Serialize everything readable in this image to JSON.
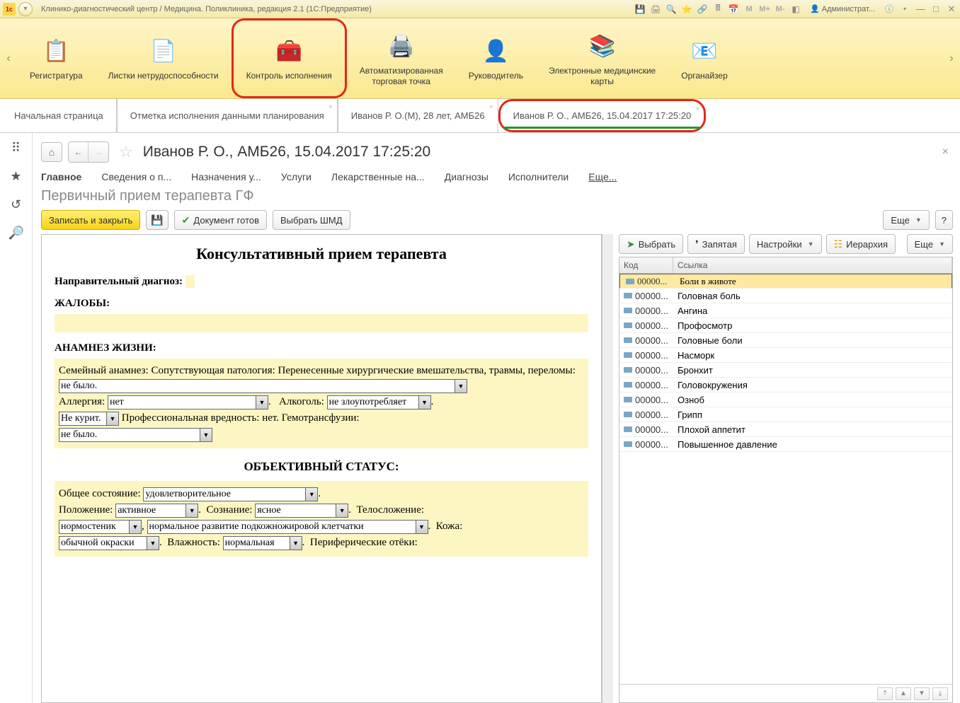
{
  "titlebar": {
    "app_title": "Клинико-диагностический центр / Медицина. Поликлиника, редакция 2.1  (1С:Предприятие)",
    "user": "Администрат...",
    "icons": {
      "m": "M",
      "mplus": "M+",
      "mminus": "M-"
    }
  },
  "main_toolbar": {
    "items": [
      {
        "label": "Регистратура",
        "icon": "📋"
      },
      {
        "label": "Листки нетрудоспособности",
        "icon": "📄"
      },
      {
        "label": "Контроль исполнения",
        "icon": "🧰",
        "highlighted": true
      },
      {
        "label": "Автоматизированная\nторговая точка",
        "icon": "🖨️"
      },
      {
        "label": "Руководитель",
        "icon": "👤"
      },
      {
        "label": "Электронные медицинские\nкарты",
        "icon": "📚"
      },
      {
        "label": "Органайзер",
        "icon": "📧"
      }
    ]
  },
  "tabs": [
    {
      "label": "Начальная страница",
      "closable": false
    },
    {
      "label": "Отметка исполнения данными планирования",
      "closable": true
    },
    {
      "label": "Иванов Р. О.(М), 28 лет, АМБ26",
      "closable": true
    },
    {
      "label": "Иванов Р. О., АМБ26, 15.04.2017 17:25:20",
      "closable": true,
      "active": true
    }
  ],
  "pane": {
    "title": "Иванов Р. О., АМБ26, 15.04.2017 17:25:20",
    "subtitle": "Первичный прием терапевта ГФ"
  },
  "hnav": [
    "Главное",
    "Сведения о п...",
    "Назначения у...",
    "Услуги",
    "Лекарственные на...",
    "Диагнозы",
    "Исполнители",
    "Еще..."
  ],
  "cmd": {
    "save_close": "Записать и закрыть",
    "doc_ready": "Документ готов",
    "choose_shmd": "Выбрать ШМД",
    "more": "Еще",
    "help": "?"
  },
  "doc": {
    "title": "Консультативный прием терапевта",
    "diag_label": "Направительный диагноз:",
    "complaints_label": "ЖАЛОБЫ:",
    "anamnesis_label": "АНАМНЕЗ ЖИЗНИ:",
    "anamnesis_text": "Семейный анамнез:  Сопутствующая патология:   Перенесенные хирургические вмешательства, травмы, переломы:",
    "nebilo": "не было.",
    "allergy_label": "Аллергия:",
    "allergy_val": "нет",
    "alcohol_label": "Алкоголь:",
    "alcohol_val": "не злоупотребляет",
    "smoke_val": "Не курит.",
    "prof_text": "Профессиональная вредность: нет. Гемотрансфузии:",
    "nebilo2": "не было.",
    "obj_status_title": "ОБЪЕКТИВНЫЙ СТАТУС:",
    "gen_state_label": "Общее состояние:",
    "gen_state_val": "удовлетворительное",
    "position_label": "Положение:",
    "position_val": "активное",
    "conscious_label": "Сознание:",
    "conscious_val": "ясное",
    "body_label": "Телосложение:",
    "body_val": "нормостеник",
    "fat_val": "нормальное развитие подкожножировой клетчатки",
    "skin_label": "Кожа:",
    "skin_val": "обычной окраски",
    "humid_label": "Влажность:",
    "humid_val": "нормальная",
    "edema_label": "Периферические отёки:"
  },
  "right": {
    "btn_select": "Выбрать",
    "btn_comma": "Запятая",
    "btn_settings": "Настройки",
    "btn_hierarchy": "Иерархия",
    "btn_more": "Еще",
    "col_code": "Код",
    "col_link": "Ссылка",
    "rows": [
      {
        "code": "00000...",
        "link": "Боли в животе",
        "selected": true
      },
      {
        "code": "00000...",
        "link": "Головная боль"
      },
      {
        "code": "00000...",
        "link": "Ангина"
      },
      {
        "code": "00000...",
        "link": "Профосмотр"
      },
      {
        "code": "00000...",
        "link": "Головные боли"
      },
      {
        "code": "00000...",
        "link": "Насморк"
      },
      {
        "code": "00000...",
        "link": "Бронхит"
      },
      {
        "code": "00000...",
        "link": "Головокружения"
      },
      {
        "code": "00000...",
        "link": "Озноб"
      },
      {
        "code": "00000...",
        "link": "Грипп"
      },
      {
        "code": "00000...",
        "link": "Плохой аппетит"
      },
      {
        "code": "00000...",
        "link": "Повышенное давление"
      }
    ]
  }
}
